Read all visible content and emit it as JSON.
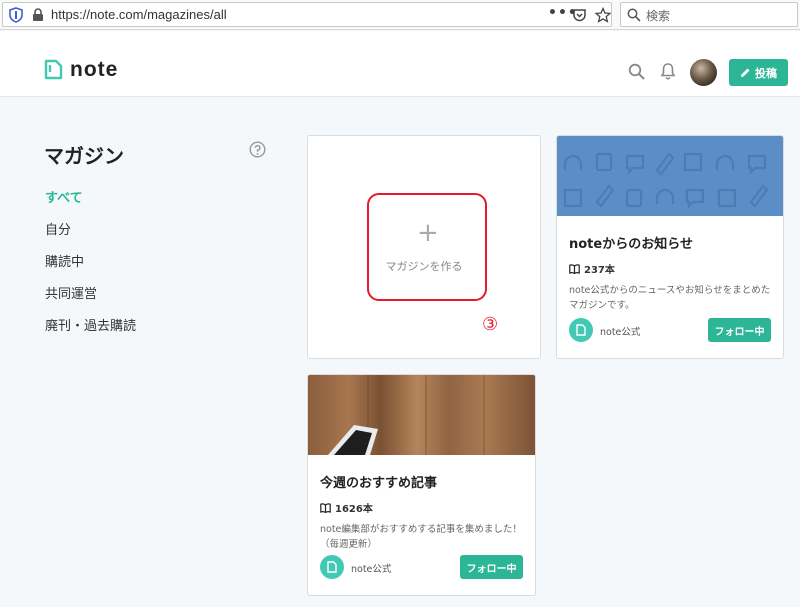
{
  "browser": {
    "url": "https://note.com/magazines/all",
    "menu_dots": "•••",
    "search_placeholder": "検索"
  },
  "header": {
    "logo_text": "note",
    "post_label": "投稿"
  },
  "sidebar": {
    "title": "マガジン",
    "items": [
      {
        "label": "すべて",
        "active": true
      },
      {
        "label": "自分"
      },
      {
        "label": "購読中"
      },
      {
        "label": "共同運営"
      },
      {
        "label": "廃刊・過去購読"
      }
    ]
  },
  "create_card": {
    "plus": "+",
    "label": "マガジンを作る",
    "annotation": "③"
  },
  "magazines": [
    {
      "title": "noteからのお知らせ",
      "count": "237本",
      "description": "note公式からのニュースやお知らせをまとめたマガジンです。",
      "owner": "note公式",
      "follow_label": "フォロー中"
    },
    {
      "title": "今週のおすすめ記事",
      "count": "1626本",
      "description": "note編集部がおすすめする記事を集めました！（毎週更新）",
      "owner": "note公式",
      "follow_label": "フォロー中"
    }
  ],
  "colors": {
    "accent": "#2cb696",
    "annotation_red": "#e8192c",
    "cover_blue": "#5b8ec6"
  }
}
